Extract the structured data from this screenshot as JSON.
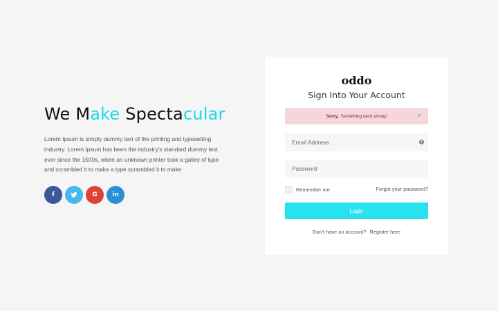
{
  "hero": {
    "headline_part1": "We ",
    "headline_part2": "M",
    "headline_part3": "ake ",
    "headline_part4": "S",
    "headline_part5": "pecta",
    "headline_part6": "cular",
    "description": "Lorem Ipsum is simply dummy text of the printing and typesetting industry. Lorem Ipsum has been the industry's standard dummy text ever since the 1500s, when an unknown printer took a galley of type and scrambled it to make a type scrambled it to make",
    "socials": [
      {
        "name": "facebook",
        "glyph": "f",
        "color": "#3b5998"
      },
      {
        "name": "twitter",
        "glyph": "twitter-bird",
        "color": "#47b8ef"
      },
      {
        "name": "google",
        "glyph": "G",
        "color": "#db4437"
      },
      {
        "name": "linkedin",
        "glyph": "in",
        "color": "#2b8fd8"
      }
    ]
  },
  "card": {
    "brand": "oddo",
    "title": "Sign Into Your Account",
    "alert": {
      "strong": "Sorry,",
      "message": "Something went wrong!",
      "close": "×"
    },
    "email_placeholder": "Email Address",
    "password_placeholder": "Password",
    "remember_label": "Remember me",
    "forgot_label": "Forgot your password?",
    "login_label": "Login",
    "no_account_text": "Don't have an account?",
    "register_label": "Register here",
    "accent_color": "#28e3ef"
  }
}
